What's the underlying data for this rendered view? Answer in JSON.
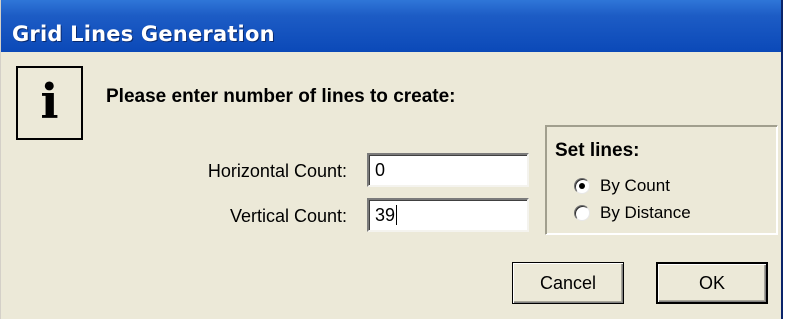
{
  "window": {
    "title": "Grid Lines Generation"
  },
  "dialog": {
    "icon": "i",
    "prompt": "Please enter number of lines to create:",
    "horizontal_label": "Horizontal Count:",
    "horizontal_value": "0",
    "vertical_label": "Vertical Count:",
    "vertical_value": "39"
  },
  "set_lines": {
    "title": "Set lines:",
    "options": [
      {
        "label": "By Count",
        "selected": true
      },
      {
        "label": "By Distance",
        "selected": false
      }
    ]
  },
  "buttons": {
    "cancel": "Cancel",
    "ok": "OK"
  },
  "colors": {
    "titlebar": "#0b49b8",
    "dialog_bg": "#ece9d8",
    "title_text": "#ffffff"
  },
  "icons": {
    "info": "info-icon"
  }
}
